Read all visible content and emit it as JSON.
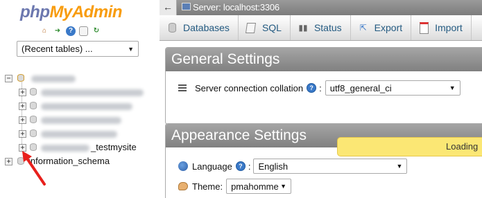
{
  "logo": {
    "part1": "php",
    "part2": "MyAdmin"
  },
  "nav_icons": [
    "home-icon",
    "logout-icon",
    "help-icon",
    "copy-icon",
    "reload-icon"
  ],
  "recent_tables": {
    "value": "(Recent tables) ..."
  },
  "tree": {
    "visible_db_suffix": "_testmysite",
    "information_schema": "information_schema"
  },
  "topbar": {
    "back": "←",
    "server": "Server: localhost:3306"
  },
  "tabs": [
    {
      "label": "Databases",
      "icon": "database-icon"
    },
    {
      "label": "SQL",
      "icon": "sql-icon"
    },
    {
      "label": "Status",
      "icon": "status-icon"
    },
    {
      "label": "Export",
      "icon": "export-icon"
    },
    {
      "label": "Import",
      "icon": "import-icon"
    }
  ],
  "general_settings": {
    "title": "General Settings",
    "collation_label": "Server connection collation",
    "collation_value": "utf8_general_ci"
  },
  "appearance_settings": {
    "title": "Appearance Settings",
    "language_label": "Language",
    "language_value": "English",
    "theme_label": "Theme:",
    "theme_value": "pmahomme"
  },
  "loading": "Loading",
  "colors": {
    "accent": "#235a81",
    "logo_php": "#6c78af",
    "logo_myadmin": "#f89c0e",
    "annotation_arrow": "#e8201c",
    "loading_bg": "#fbe774"
  }
}
